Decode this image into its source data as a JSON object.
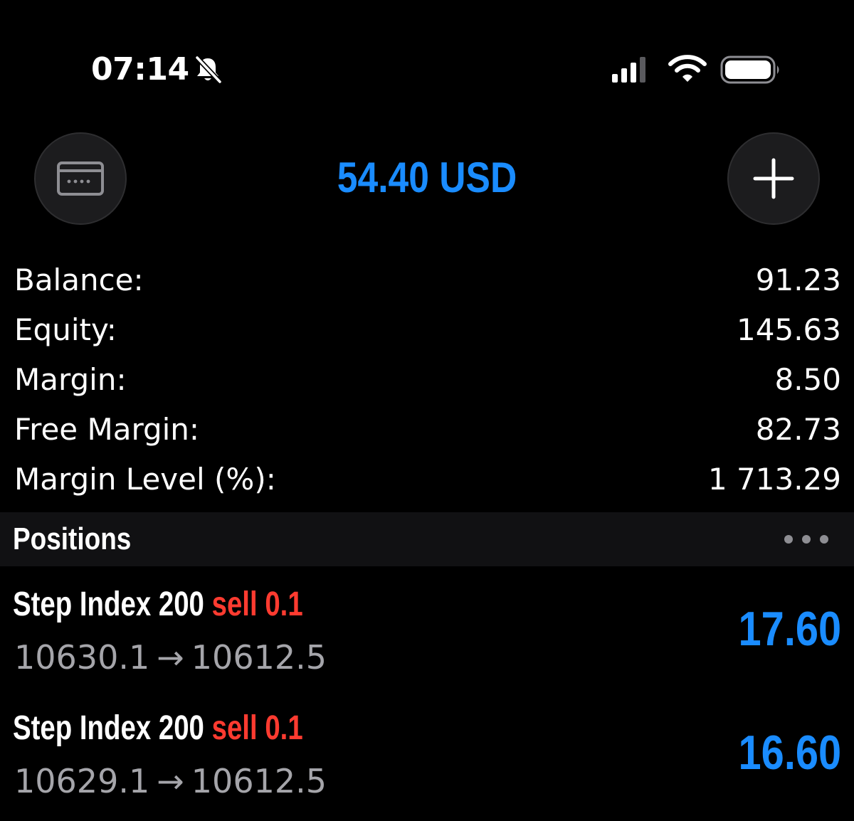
{
  "status_bar": {
    "time": "07:14",
    "icons": [
      "bell-slash-icon",
      "cellular-signal-icon",
      "wifi-icon",
      "battery-icon"
    ]
  },
  "header": {
    "left_icon": "card-icon",
    "equity_display": "54.40 USD",
    "right_icon": "plus-icon",
    "accent_color": "#1a8cff"
  },
  "summary": {
    "rows": [
      {
        "label": "Balance:",
        "value": "91.23"
      },
      {
        "label": "Equity:",
        "value": "145.63"
      },
      {
        "label": "Margin:",
        "value": "8.50"
      },
      {
        "label": "Free Margin:",
        "value": "82.73"
      },
      {
        "label": "Margin Level (%):",
        "value": "1 713.29"
      }
    ]
  },
  "positions": {
    "title": "Positions",
    "menu_icon": "more-horizontal-icon",
    "items": [
      {
        "symbol": "Step Index 200",
        "side": "sell",
        "volume": "0.1",
        "open_price": "10630.1",
        "arrow": "→",
        "current_price": "10612.5",
        "profit": "17.60"
      },
      {
        "symbol": "Step Index 200",
        "side": "sell",
        "volume": "0.1",
        "open_price": "10629.1",
        "arrow": "→",
        "current_price": "10612.5",
        "profit": "16.60"
      }
    ],
    "sell_color": "#ff3b30",
    "profit_color": "#1a8cff"
  }
}
